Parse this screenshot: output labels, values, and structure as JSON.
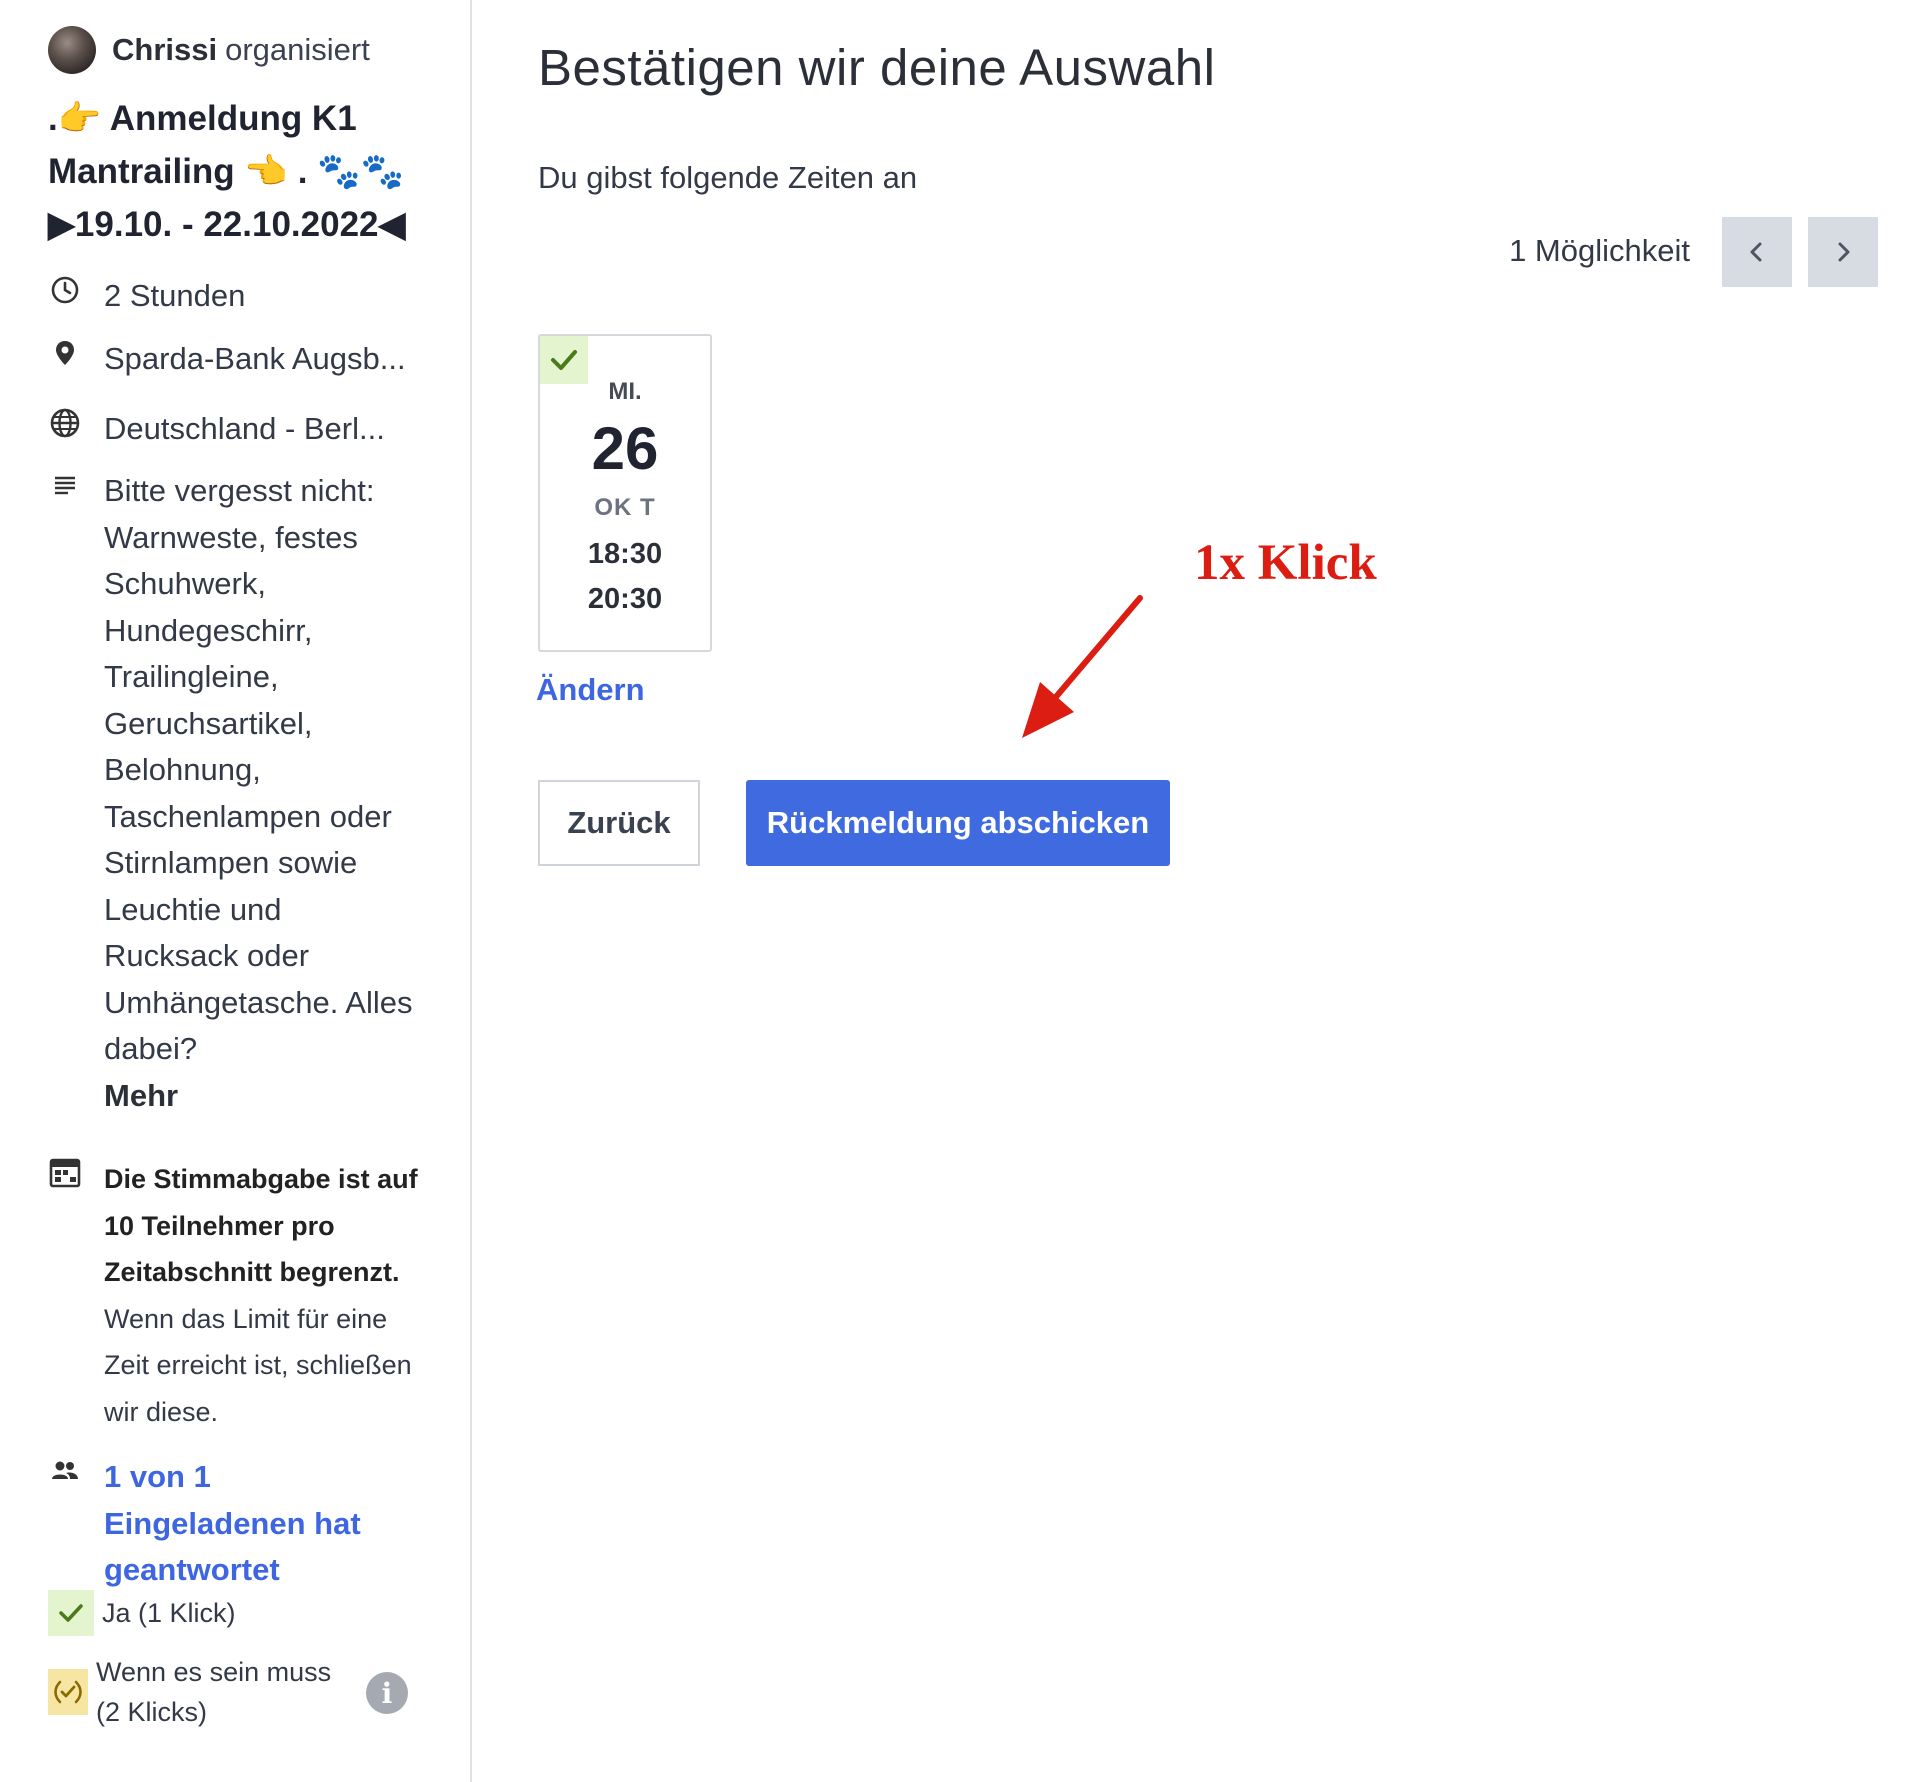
{
  "sidebar": {
    "organizer": {
      "name": "Chrissi",
      "suffix": "organisiert"
    },
    "event_title": ".👉 Anmeldung K1 Mantrailing 👈 . 🐾🐾 ▶19.10. - 22.10.2022◀",
    "duration": "2 Stunden",
    "location": "Sparda-Bank Augsb...",
    "timezone": "Deutschland - Berl...",
    "description": "Bitte vergesst nicht: Warnweste, festes Schuhwerk, Hundegeschirr, Trailingleine, Geruchsartikel, Belohnung, Taschenlampen oder Stirnlampen sowie Leuchtie und Rucksack oder Umhängetasche. Alles dabei?",
    "more_label": "Mehr",
    "limit_bold": "Die Stimmabgabe ist auf 10 Teilnehmer pro Zeitabschnitt begrenzt.",
    "limit_text": "Wenn das Limit für eine Zeit erreicht ist, schließen wir diese.",
    "invited": "1 von 1 Eingeladenen hat geantwortet",
    "legend_yes": "Ja (1 Klick)",
    "legend_maybe": "Wenn es sein muss (2 Klicks)",
    "icons": [
      "clock-icon",
      "location-pin-icon",
      "globe-icon",
      "description-icon",
      "calendar-grid-icon",
      "people-icon",
      "check-icon",
      "maybe-check-icon",
      "info-icon"
    ]
  },
  "main": {
    "title": "Bestätigen wir deine Auswahl",
    "subtitle": "Du gibst folgende Zeiten an",
    "pager_label": "1 Möglichkeit",
    "card": {
      "weekday": "MI.",
      "day": "26",
      "month": "OK T",
      "start": "18:30",
      "end": "20:30"
    },
    "change_label": "Ändern",
    "back_label": "Zurück",
    "submit_label": "Rückmeldung abschicken",
    "annotation": "1x Klick"
  },
  "colors": {
    "accent": "#3f6ae0",
    "link": "#3d66e0",
    "yes_bg": "#e4f4cf",
    "maybe_bg": "#f7e6a3",
    "annotation": "#dc1d12",
    "pager_bg": "#d7dce2"
  }
}
